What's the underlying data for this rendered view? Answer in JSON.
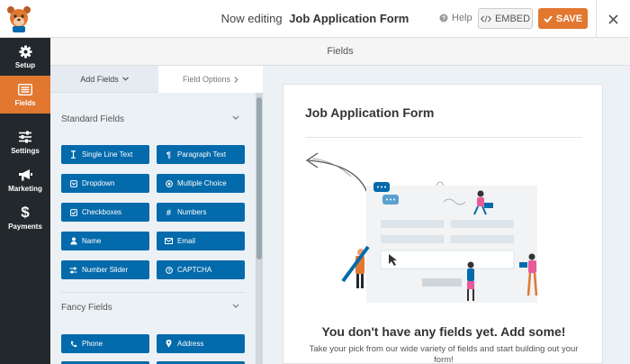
{
  "header": {
    "editing_prefix": "Now editing",
    "form_name": "Job Application Form",
    "help_label": "Help",
    "embed_label": "EMBED",
    "save_label": "SAVE"
  },
  "nav": {
    "items": [
      {
        "label": "Setup",
        "icon": "gear-icon"
      },
      {
        "label": "Fields",
        "icon": "list-icon",
        "active": true
      },
      {
        "label": "Settings",
        "icon": "sliders-icon"
      },
      {
        "label": "Marketing",
        "icon": "megaphone-icon"
      },
      {
        "label": "Payments",
        "icon": "dollar-icon"
      }
    ]
  },
  "fields_header": "Fields",
  "panel": {
    "tabs": {
      "add": "Add Fields",
      "options": "Field Options"
    },
    "standard_title": "Standard Fields",
    "fancy_title": "Fancy Fields",
    "standard_fields": [
      {
        "label": "Single Line Text",
        "icon": "text-cursor-icon"
      },
      {
        "label": "Paragraph Text",
        "icon": "paragraph-icon"
      },
      {
        "label": "Dropdown",
        "icon": "dropdown-icon"
      },
      {
        "label": "Multiple Choice",
        "icon": "radio-icon"
      },
      {
        "label": "Checkboxes",
        "icon": "checkbox-icon"
      },
      {
        "label": "Numbers",
        "icon": "hash-icon"
      },
      {
        "label": "Name",
        "icon": "user-icon"
      },
      {
        "label": "Email",
        "icon": "envelope-icon"
      },
      {
        "label": "Number Slider",
        "icon": "slider-icon"
      },
      {
        "label": "CAPTCHA",
        "icon": "question-circle-icon"
      }
    ],
    "fancy_fields": [
      {
        "label": "Phone",
        "icon": "phone-icon"
      },
      {
        "label": "Address",
        "icon": "map-marker-icon"
      }
    ]
  },
  "preview": {
    "form_title": "Job Application Form",
    "empty_heading": "You don't have any fields yet. Add some!",
    "empty_sub": "Take your pick from our wide variety of fields and start building out your form!"
  },
  "colors": {
    "accent": "#e27730",
    "field_button": "#036aab",
    "nav_bg": "#23282d"
  }
}
